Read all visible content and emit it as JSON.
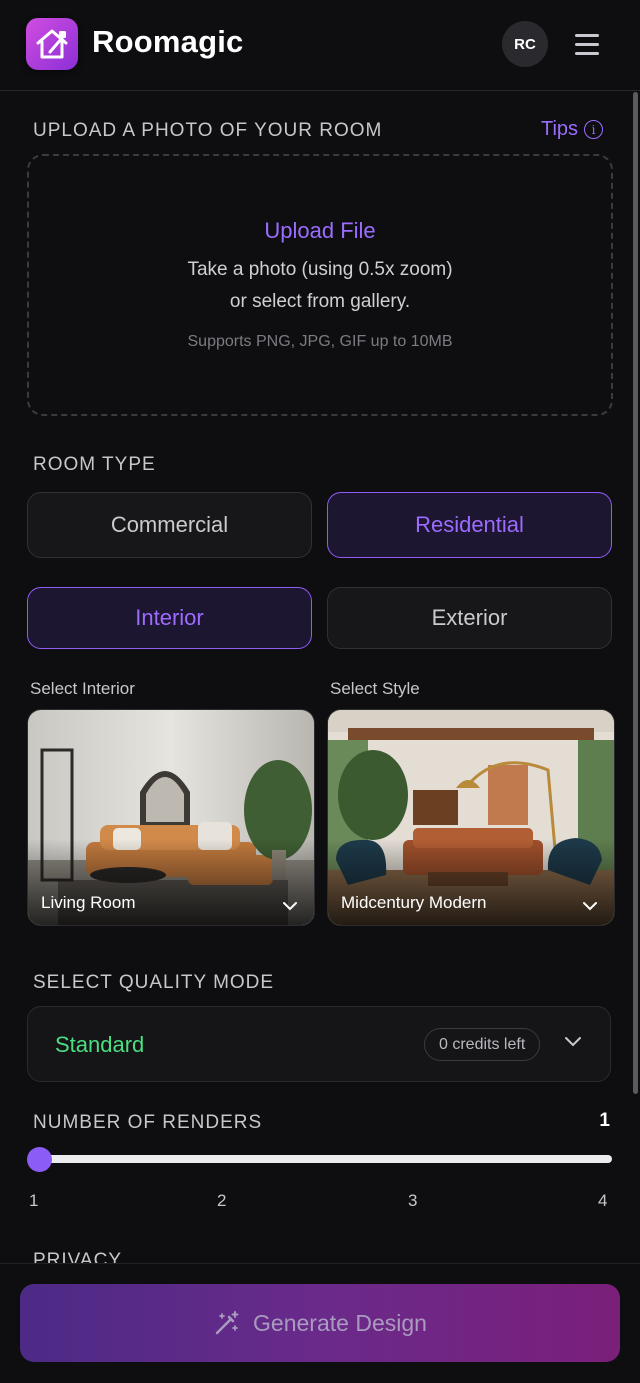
{
  "header": {
    "app_name": "Roomagic",
    "avatar_initials": "RC"
  },
  "upload": {
    "section_label": "UPLOAD A PHOTO OF YOUR ROOM",
    "tips_label": "Tips",
    "title": "Upload File",
    "line1": "Take a photo (using 0.5x zoom)",
    "line2": "or select from gallery.",
    "note": "Supports PNG, JPG, GIF up to 10MB"
  },
  "room_type": {
    "label": "ROOM TYPE",
    "options": [
      "Commercial",
      "Residential"
    ],
    "selected": "Residential",
    "sub_options": [
      "Interior",
      "Exterior"
    ],
    "sub_selected": "Interior"
  },
  "selectors": {
    "interior_label": "Select Interior",
    "interior_value": "Living Room",
    "style_label": "Select Style",
    "style_value": "Midcentury Modern"
  },
  "quality": {
    "label": "SELECT QUALITY MODE",
    "value": "Standard",
    "credits": "0 credits left"
  },
  "renders": {
    "label": "NUMBER OF RENDERS",
    "value": "1",
    "ticks": [
      "1",
      "2",
      "3",
      "4"
    ]
  },
  "privacy": {
    "label": "PRIVACY"
  },
  "generate": {
    "label": "Generate Design"
  },
  "colors": {
    "accent": "#8b5cf6",
    "standard_green": "#4ade80"
  }
}
